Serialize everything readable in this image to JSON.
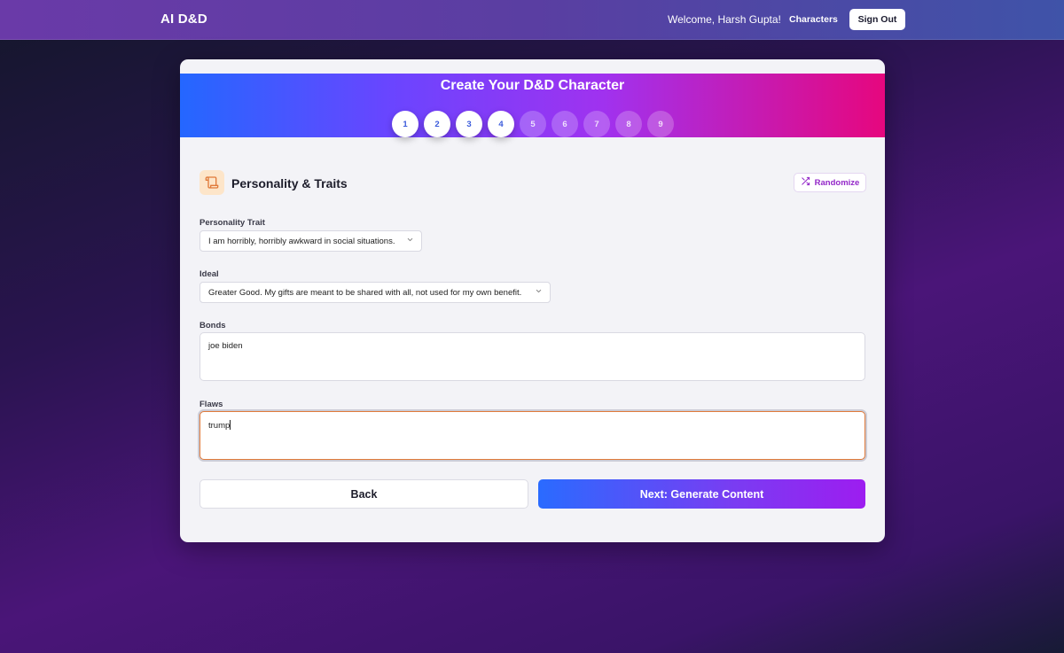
{
  "nav": {
    "brand": "AI D&D",
    "welcome": "Welcome, Harsh Gupta!",
    "characters_link": "Characters",
    "sign_out": "Sign Out"
  },
  "wizard": {
    "title": "Create Your D&D Character",
    "steps": [
      "1",
      "2",
      "3",
      "4",
      "5",
      "6",
      "7",
      "8",
      "9"
    ],
    "completed_steps": 4
  },
  "section": {
    "icon": "scroll-icon",
    "title": "Personality & Traits",
    "randomize_label": "Randomize",
    "randomize_icon": "shuffle-icon"
  },
  "form": {
    "personality_trait": {
      "label": "Personality Trait",
      "value": "I am horribly, horribly awkward in social situations."
    },
    "ideal": {
      "label": "Ideal",
      "value": "Greater Good. My gifts are meant to be shared with all, not used for my own benefit."
    },
    "bonds": {
      "label": "Bonds",
      "value": "joe biden"
    },
    "flaws": {
      "label": "Flaws",
      "value": "trump"
    }
  },
  "actions": {
    "back": "Back",
    "next": "Next: Generate Content"
  },
  "colors": {
    "accent_purple": "#9327c8",
    "icon_orange": "#e07a3a",
    "focus_border": "#e07a3a"
  }
}
